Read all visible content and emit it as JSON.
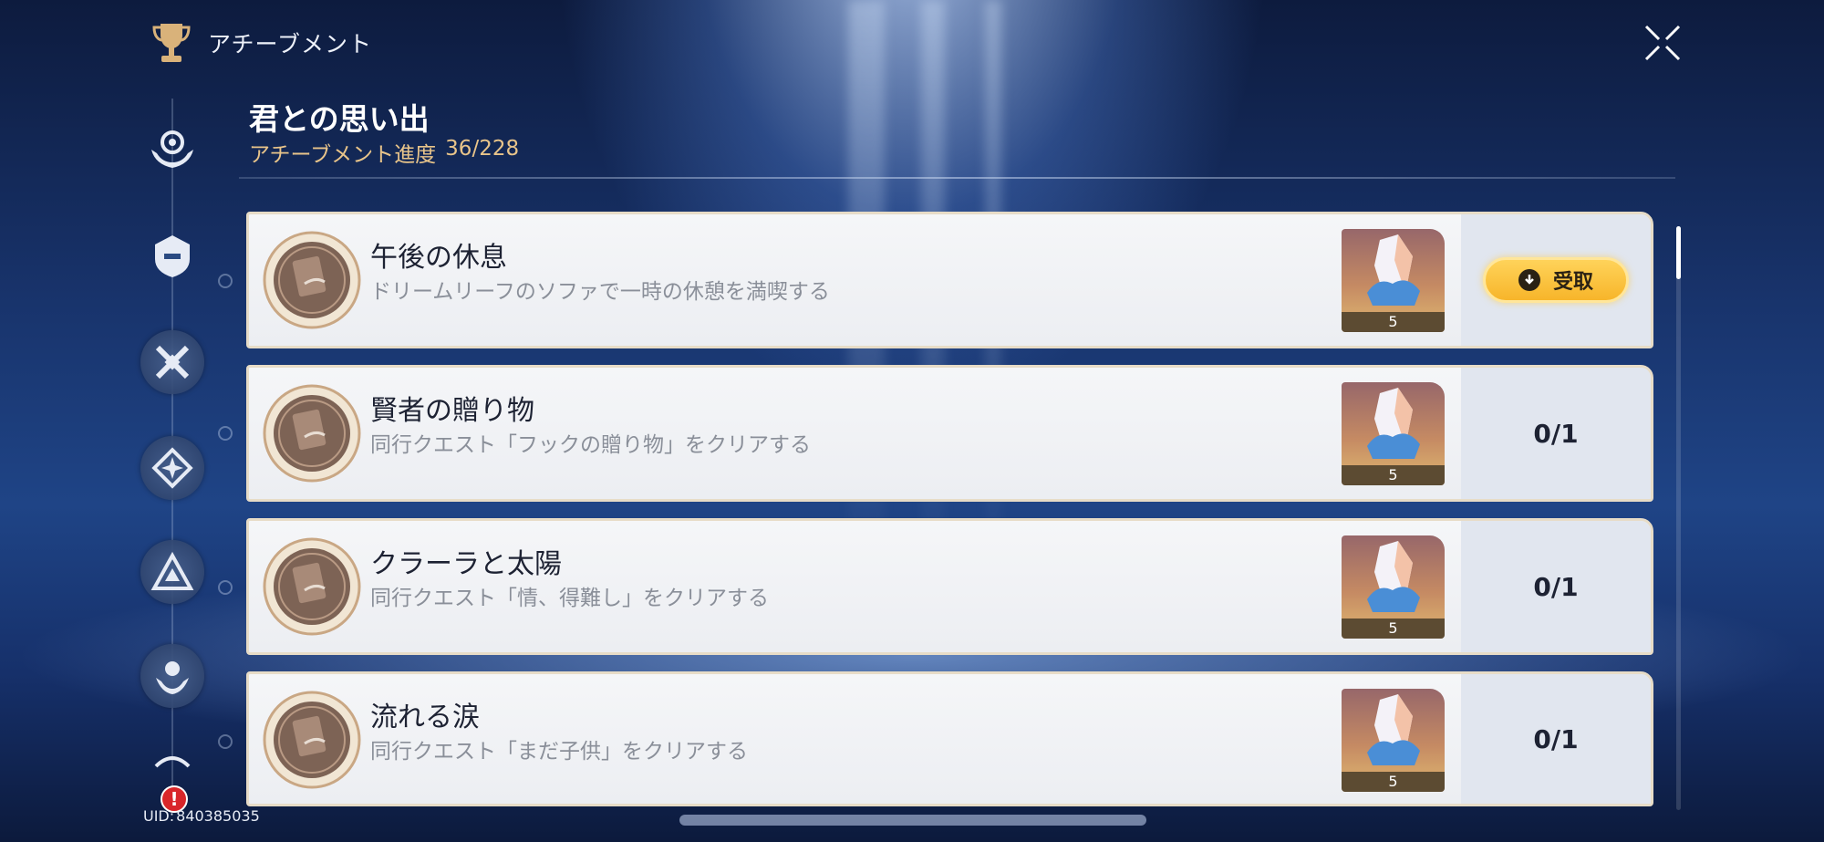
{
  "header": {
    "title": "アチーブメント",
    "icon": "trophy-icon"
  },
  "section": {
    "title": "君との思い出",
    "progress_label": "アチーブメント進度",
    "progress_value": "36/228"
  },
  "sidebar": {
    "items": [
      {
        "icon": "hands-gear-icon"
      },
      {
        "icon": "helmet-emblem-icon"
      },
      {
        "icon": "crossed-swords-icon"
      },
      {
        "icon": "diamond-star-icon"
      },
      {
        "icon": "triangle-emblem-icon"
      },
      {
        "icon": "flower-hands-icon"
      },
      {
        "icon": "partial-emblem-icon"
      }
    ]
  },
  "achievements": [
    {
      "name": "午後の休息",
      "description": "ドリームリーフのソファで一時の休憩を満喫する",
      "reward_qty": "5",
      "status": "claim",
      "claim_label": "受取"
    },
    {
      "name": "賢者の贈り物",
      "description": "同行クエスト「フックの贈り物」をクリアする",
      "reward_qty": "5",
      "status": "progress",
      "progress": "0/1"
    },
    {
      "name": "クラーラと太陽",
      "description": "同行クエスト「情、得難し」をクリアする",
      "reward_qty": "5",
      "status": "progress",
      "progress": "0/1"
    },
    {
      "name": "流れる涙",
      "description": "同行クエスト「まだ子供」をクリアする",
      "reward_qty": "5",
      "status": "progress",
      "progress": "0/1"
    }
  ],
  "footer": {
    "uid_label": "UID:",
    "uid_value": "840385035",
    "alert_symbol": "!"
  },
  "colors": {
    "accent_gold": "#e8c48a",
    "claim_button": "#f7b52a",
    "card_bg": "#f5f6f8"
  }
}
